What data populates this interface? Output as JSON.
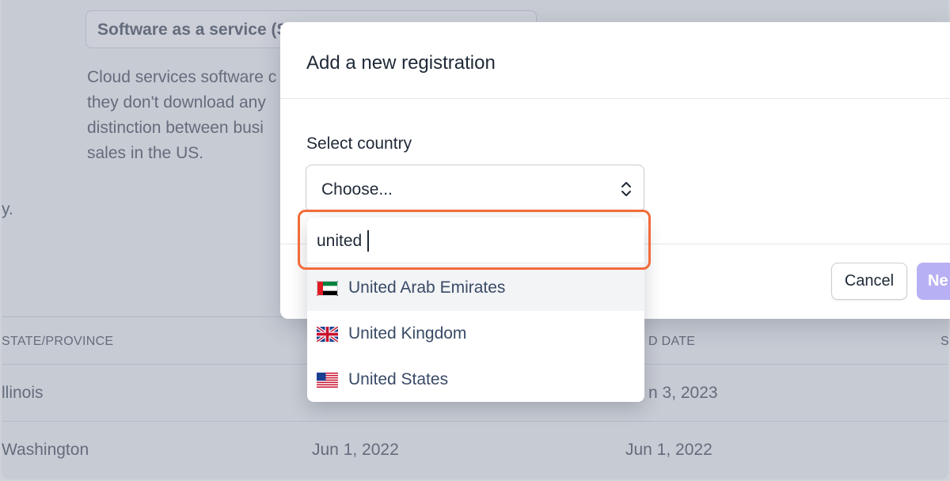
{
  "background": {
    "tax_code_value": "Software as a service (S",
    "description_lines": [
      "Cloud services software c",
      "they don't download any",
      "distinction between busi",
      "sales in the US."
    ],
    "stub_text": "y.",
    "table": {
      "headers": [
        "STATE/PROVINCE",
        "D DATE",
        "S"
      ],
      "rows": [
        [
          "llinois",
          "",
          "n 3, 2023"
        ],
        [
          "Washington",
          "Jun 1, 2022",
          "Jun 1, 2022"
        ]
      ]
    }
  },
  "modal": {
    "title": "Add a new registration",
    "field_label": "Select country",
    "select_value": "Choose...",
    "cancel_label": "Cancel",
    "next_label": "Ne"
  },
  "dropdown": {
    "search_value": "united",
    "options": [
      {
        "label": "United Arab Emirates",
        "flag": "flag-uae-icon"
      },
      {
        "label": "United Kingdom",
        "flag": "flag-uk-icon"
      },
      {
        "label": "United States",
        "flag": "flag-us-icon"
      }
    ]
  },
  "colors": {
    "accent_disabled": "#b8b0f4",
    "highlight_annotation": "#f26b3a",
    "option_text": "#394a66"
  }
}
